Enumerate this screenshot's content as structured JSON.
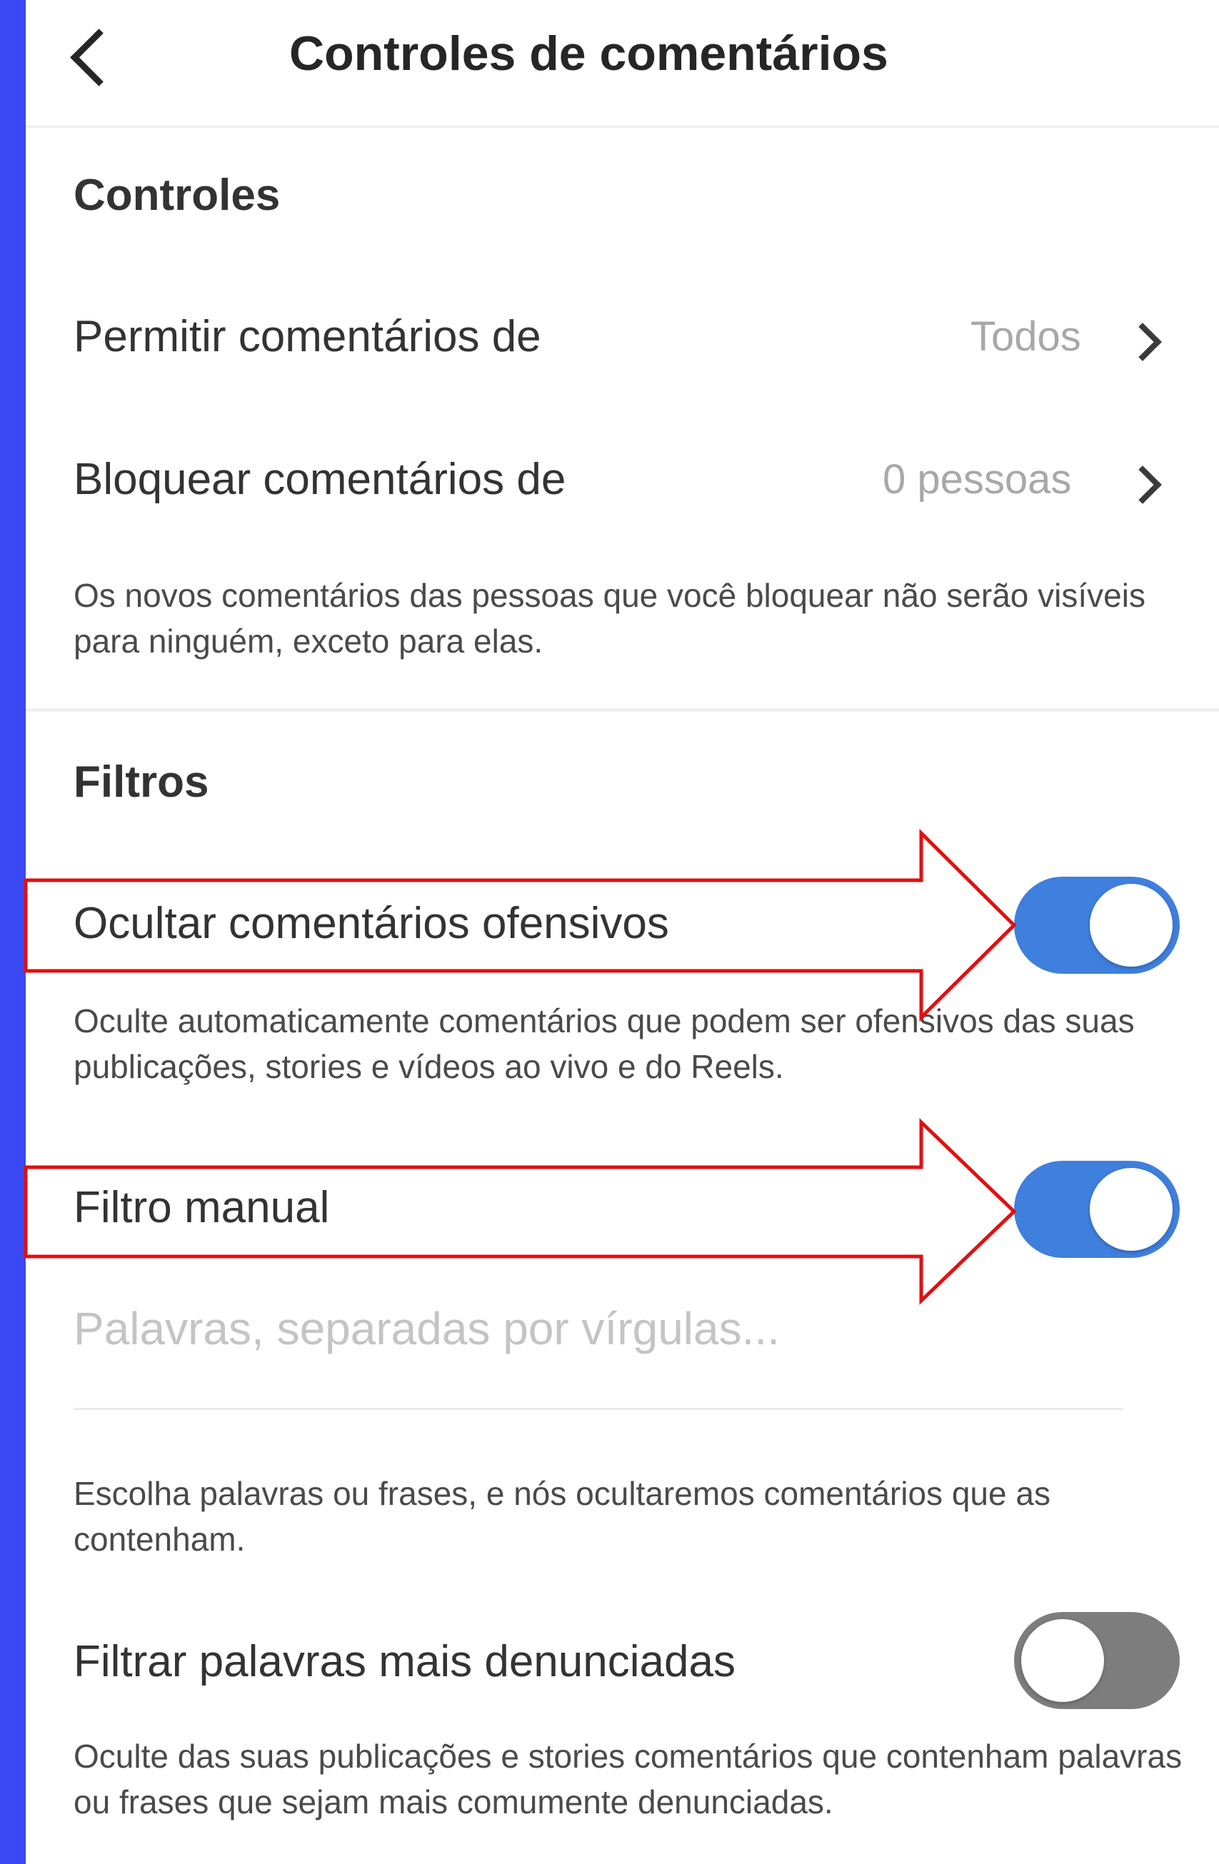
{
  "header": {
    "title": "Controles de comentários"
  },
  "controls": {
    "section_title": "Controles",
    "allow_comments": {
      "label": "Permitir comentários de",
      "value": "Todos"
    },
    "block_comments": {
      "label": "Bloquear comentários de",
      "value": "0 pessoas"
    },
    "block_description": "Os novos comentários das pessoas que você bloquear não serão visíveis para ninguém, exceto para elas."
  },
  "filters": {
    "section_title": "Filtros",
    "hide_offensive": {
      "label": "Ocultar comentários ofensivos",
      "enabled": true,
      "description": "Oculte automaticamente comentários que podem ser ofensivos das suas publicações, stories e vídeos ao vivo e do Reels."
    },
    "manual_filter": {
      "label": "Filtro manual",
      "enabled": true,
      "placeholder": "Palavras, separadas por vírgulas...",
      "description": "Escolha palavras ou frases, e nós ocultaremos comentários que as contenham."
    },
    "most_reported": {
      "label": "Filtrar palavras mais denunciadas",
      "enabled": false,
      "description": "Oculte das suas publicações e stories comentários que contenham palavras ou frases que sejam mais comumente denunciadas."
    }
  },
  "colors": {
    "side_bar": "#3b49f5",
    "toggle_on": "#3f7fde",
    "toggle_off": "#7d7d7d",
    "annotation_arrow": "#e01010"
  }
}
